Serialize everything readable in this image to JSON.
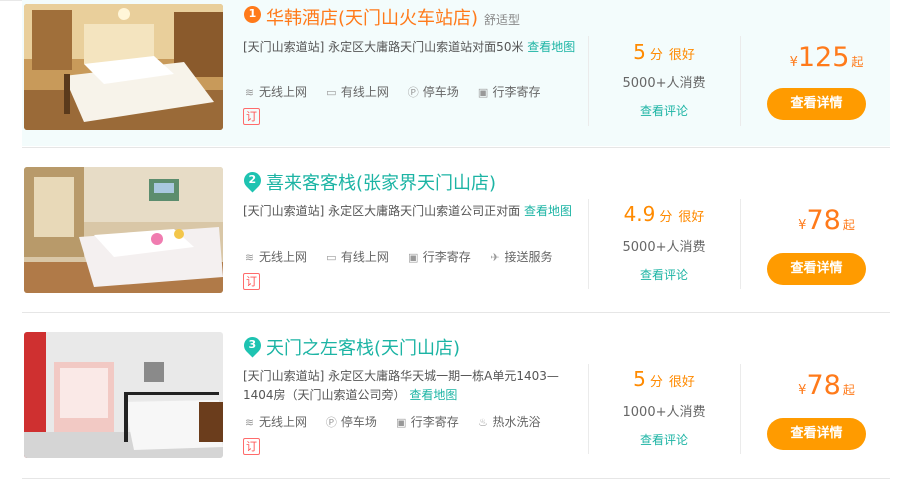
{
  "hotels": [
    {
      "rank": "1",
      "name": "华韩酒店(天门山火车站店)",
      "tag": "舒适型",
      "address_prefix": "[天门山索道站] 永定区大庸路天门山索道站对面50米",
      "map_link": "查看地图",
      "facilities": [
        {
          "icon": "wifi-icon",
          "label": "无线上网"
        },
        {
          "icon": "monitor-icon",
          "label": "有线上网"
        },
        {
          "icon": "parking-icon",
          "label": "停车场"
        },
        {
          "icon": "luggage-icon",
          "label": "行李寄存"
        }
      ],
      "book_badge": "订",
      "score": "5",
      "score_unit": "分",
      "level": "很好",
      "consumers": "5000+人消费",
      "review_link": "查看评论",
      "currency": "¥",
      "price": "125",
      "price_suffix": "起",
      "button": "查看详情"
    },
    {
      "rank": "2",
      "name": "喜来客客栈(张家界天门山店)",
      "tag": "",
      "address_prefix": "[天门山索道站] 永定区大庸路天门山索道公司正对面",
      "map_link": "查看地图",
      "facilities": [
        {
          "icon": "wifi-icon",
          "label": "无线上网"
        },
        {
          "icon": "monitor-icon",
          "label": "有线上网"
        },
        {
          "icon": "luggage-icon",
          "label": "行李寄存"
        },
        {
          "icon": "plane-icon",
          "label": "接送服务"
        }
      ],
      "book_badge": "订",
      "score": "4.9",
      "score_unit": "分",
      "level": "很好",
      "consumers": "5000+人消费",
      "review_link": "查看评论",
      "currency": "¥",
      "price": "78",
      "price_suffix": "起",
      "button": "查看详情"
    },
    {
      "rank": "3",
      "name": "天门之左客栈(天门山店)",
      "tag": "",
      "address_prefix": "[天门山索道站] 永定区大庸路华天城一期一栋A单元1403—1404房（天门山索道公司旁）",
      "map_link": "查看地图",
      "facilities": [
        {
          "icon": "wifi-icon",
          "label": "无线上网"
        },
        {
          "icon": "parking-icon",
          "label": "停车场"
        },
        {
          "icon": "luggage-icon",
          "label": "行李寄存"
        },
        {
          "icon": "shower-icon",
          "label": "热水洗浴"
        }
      ],
      "book_badge": "订",
      "score": "5",
      "score_unit": "分",
      "level": "很好",
      "consumers": "1000+人消费",
      "review_link": "查看评论",
      "currency": "¥",
      "price": "78",
      "price_suffix": "起",
      "button": "查看详情"
    }
  ],
  "colors": {
    "brand_teal": "#1cb4a4",
    "accent_orange": "#ff7a1a",
    "button_orange": "#ff9b00",
    "highlight_bg": "#f3fcfc"
  }
}
